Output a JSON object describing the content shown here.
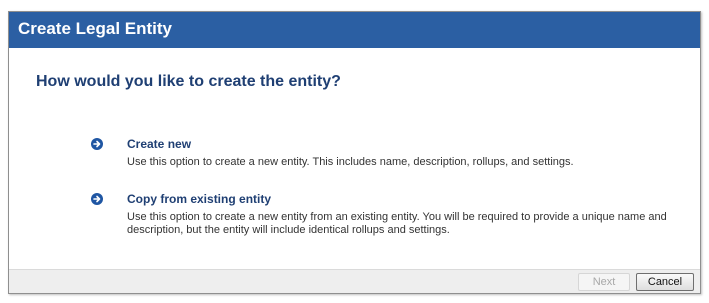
{
  "dialog": {
    "title": "Create Legal Entity",
    "question": "How would you like to create the entity?"
  },
  "options": [
    {
      "title": "Create new",
      "description": "Use this option to create a new entity. This includes name, description, rollups, and settings.",
      "icon": "arrow-right-circle-icon"
    },
    {
      "title": "Copy from existing entity",
      "description": "Use this option to create a new entity from an existing entity. You will be required to provide a unique name and description, but the entity will include identical rollups and settings.",
      "icon": "arrow-right-circle-icon"
    }
  ],
  "footer": {
    "next_label": "Next",
    "next_enabled": false,
    "cancel_label": "Cancel"
  },
  "colors": {
    "titlebar": "#2b5fa3",
    "heading": "#1f3f73",
    "footer": "#eeeeee"
  }
}
